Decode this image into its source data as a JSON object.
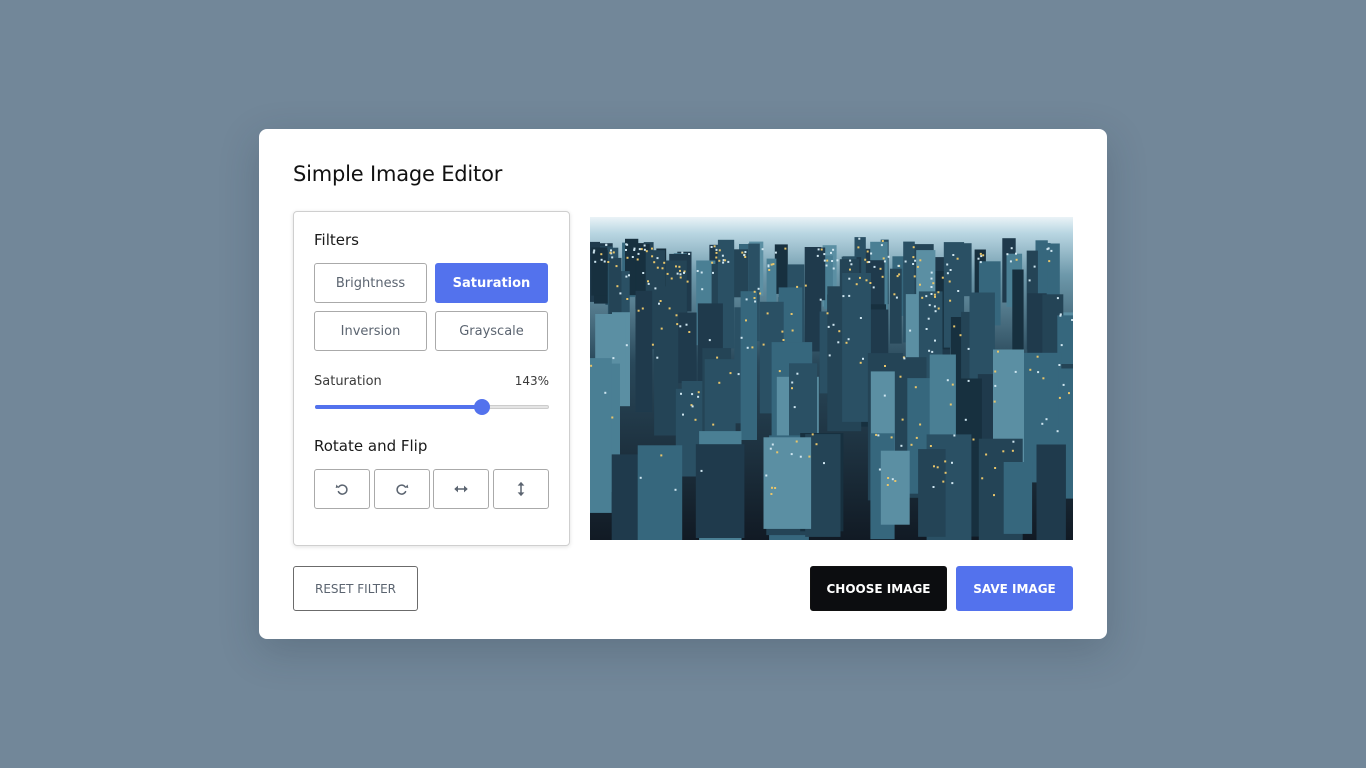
{
  "app": {
    "title": "Simple Image Editor"
  },
  "filters": {
    "heading": "Filters",
    "buttons": [
      {
        "label": "Brightness",
        "active": false
      },
      {
        "label": "Saturation",
        "active": true
      },
      {
        "label": "Inversion",
        "active": false
      },
      {
        "label": "Grayscale",
        "active": false
      }
    ],
    "slider": {
      "name": "Saturation",
      "value_text": "143%",
      "value": 143,
      "max": 200
    }
  },
  "rotate": {
    "heading": "Rotate and Flip",
    "buttons": [
      {
        "icon": "rotate-left-icon"
      },
      {
        "icon": "rotate-right-icon"
      },
      {
        "icon": "flip-horizontal-icon"
      },
      {
        "icon": "flip-vertical-icon"
      }
    ]
  },
  "preview": {
    "icon": "city-skyline-image"
  },
  "actions": {
    "reset_label": "RESET FILTER",
    "choose_label": "CHOOSE IMAGE",
    "save_label": "SAVE IMAGE"
  },
  "colors": {
    "accent": "#5372ed",
    "background": "#728799",
    "dark_button": "#0c0d10"
  }
}
